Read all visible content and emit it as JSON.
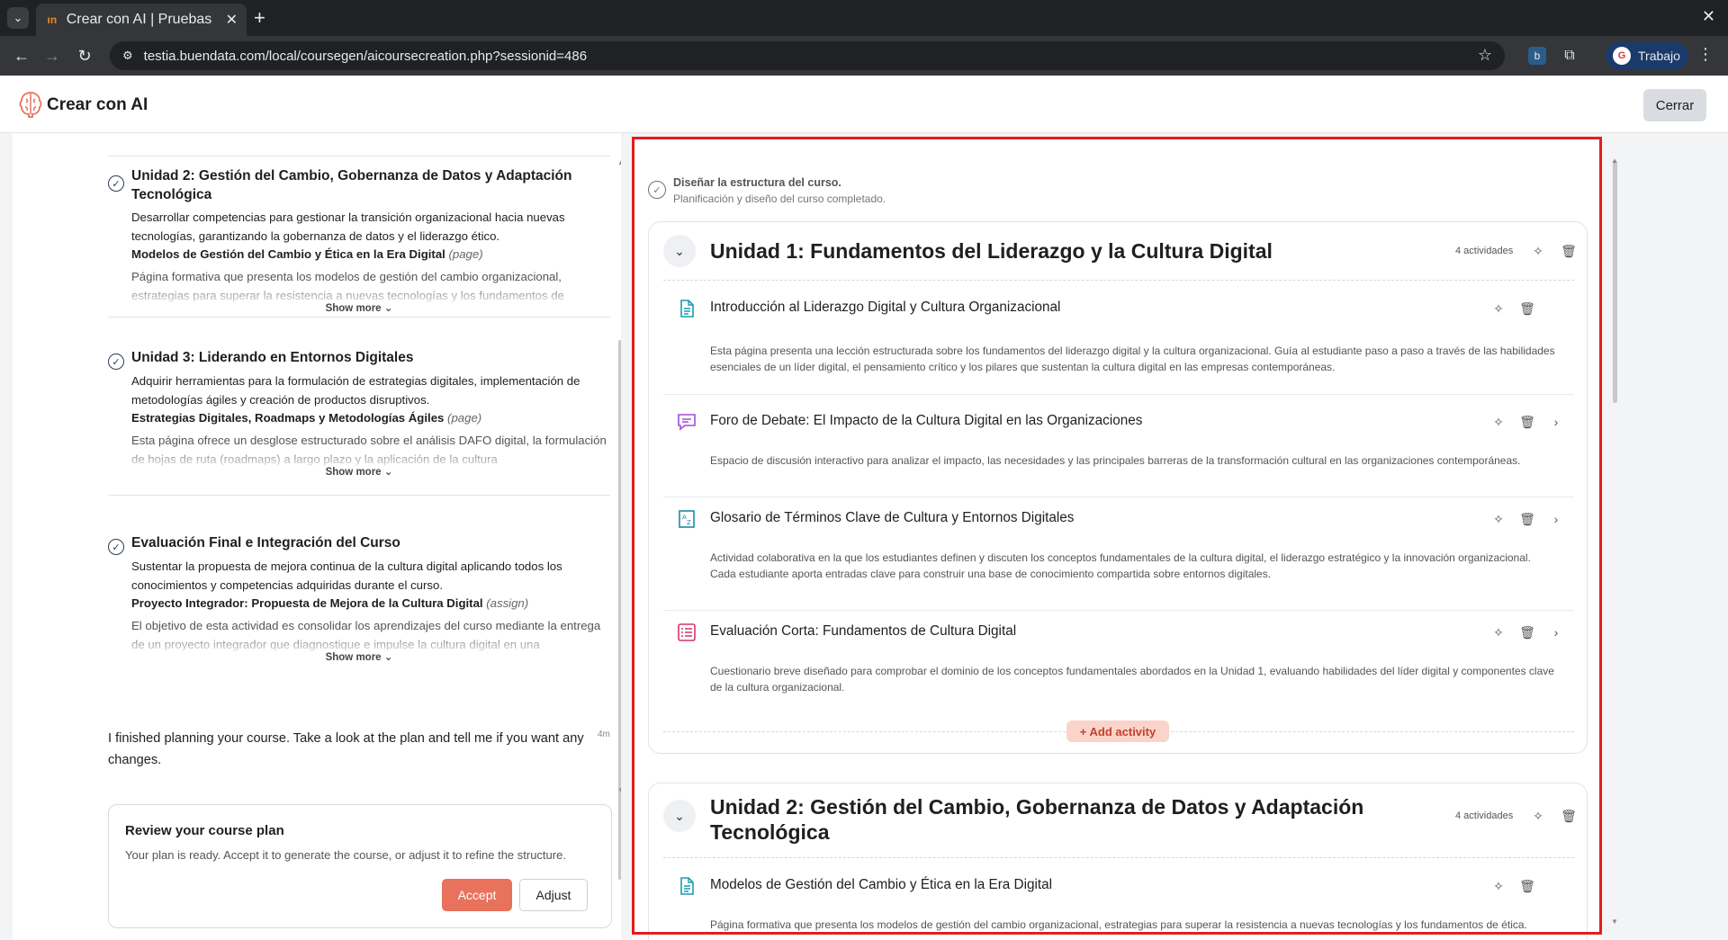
{
  "browser": {
    "tab_title": "Crear con AI | Pruebas",
    "url": "testia.buendata.com/local/coursegen/aicoursecreation.php?sessionid=486",
    "profile_label": "Trabajo"
  },
  "app": {
    "title": "Crear con AI",
    "close_label": "Cerrar"
  },
  "left": {
    "show_more_label": "Show more",
    "units": [
      {
        "title": "Unidad 2: Gestión del Cambio, Gobernanza de Datos y Adaptación Tecnológica",
        "description": "Desarrollar competencias para gestionar la transición organizacional hacia nuevas tecnologías, garantizando la gobernanza de datos y el liderazgo ético.",
        "activity_name": "Modelos de Gestión del Cambio y Ética en la Era Digital",
        "activity_type": "(page)",
        "activity_desc": "Página formativa que presenta los modelos de gestión del cambio organizacional, estrategias para superar la resistencia a nuevas tecnologías y los fundamentos de"
      },
      {
        "title": "Unidad 3: Liderando en Entornos Digitales",
        "description": "Adquirir herramientas para la formulación de estrategias digitales, implementación de metodologías ágiles y creación de productos disruptivos.",
        "activity_name": "Estrategias Digitales, Roadmaps y Metodologías Ágiles",
        "activity_type": "(page)",
        "activity_desc": "Esta página ofrece un desglose estructurado sobre el análisis DAFO digital, la formulación de hojas de ruta (roadmaps) a largo plazo y la aplicación de la cultura"
      },
      {
        "title": "Evaluación Final e Integración del Curso",
        "description": "Sustentar la propuesta de mejora continua de la cultura digital aplicando todos los conocimientos y competencias adquiridas durante el curso.",
        "activity_name": "Proyecto Integrador: Propuesta de Mejora de la Cultura Digital",
        "activity_type": "(assign)",
        "activity_desc": "El objetivo de esta actividad es consolidar los aprendizajes del curso mediante la entrega de un proyecto integrador que diagnostique e impulse la cultura digital en una"
      }
    ],
    "chat_message": "I finished planning your course. Take a look at the plan and tell me if you want any changes.",
    "chat_time": "4m",
    "review": {
      "title": "Review your course plan",
      "text": "Your plan is ready. Accept it to generate the course, or adjust it to refine the structure.",
      "accept_label": "Accept",
      "adjust_label": "Adjust"
    }
  },
  "right": {
    "step_title": "Diseñar la estructura del curso.",
    "step_subtitle": "Planificación y diseño del curso completado.",
    "add_activity_label": "+ Add activity",
    "units": [
      {
        "title": "Unidad 1: Fundamentos del Liderazgo y la Cultura Digital",
        "count": "4 actividades",
        "activities": [
          {
            "icon": "page-icon",
            "title": "Introducción al Liderazgo Digital y Cultura Organizacional",
            "desc": "Esta página presenta una lección estructurada sobre los fundamentos del liderazgo digital y la cultura organizacional. Guía al estudiante paso a paso a través de las habilidades esenciales de un líder digital, el pensamiento crítico y los pilares que sustentan la cultura digital en las empresas contemporáneas."
          },
          {
            "icon": "forum-icon",
            "title": "Foro de Debate: El Impacto de la Cultura Digital en las Organizaciones",
            "desc": "Espacio de discusión interactivo para analizar el impacto, las necesidades y las principales barreras de la transformación cultural en las organizaciones contemporáneas."
          },
          {
            "icon": "glossary-icon",
            "title": "Glosario de Términos Clave de Cultura y Entornos Digitales",
            "desc": "Actividad colaborativa en la que los estudiantes definen y discuten los conceptos fundamentales de la cultura digital, el liderazgo estratégico y la innovación organizacional. Cada estudiante aporta entradas clave para construir una base de conocimiento compartida sobre entornos digitales."
          },
          {
            "icon": "quiz-icon",
            "title": "Evaluación Corta: Fundamentos de Cultura Digital",
            "desc": "Cuestionario breve diseñado para comprobar el dominio de los conceptos fundamentales abordados en la Unidad 1, evaluando habilidades del líder digital y componentes clave de la cultura organizacional."
          }
        ]
      },
      {
        "title": "Unidad 2: Gestión del Cambio, Gobernanza de Datos y Adaptación Tecnológica",
        "count": "4 actividades",
        "activities": [
          {
            "icon": "page-icon",
            "title": "Modelos de Gestión del Cambio y Ética en la Era Digital",
            "desc": "Página formativa que presenta los modelos de gestión del cambio organizacional, estrategias para superar la resistencia a nuevas tecnologías y los fundamentos de ética."
          }
        ]
      }
    ]
  },
  "colors": {
    "accent": "#e8725b",
    "highlight": "#e41d1d",
    "page_icon": "#1a9bb0",
    "forum_icon": "#a24bd6",
    "glossary_icon": "#1a8aa8",
    "quiz_icon": "#d6336c"
  }
}
